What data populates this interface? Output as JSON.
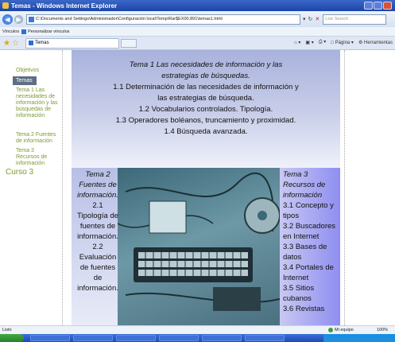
{
  "window": {
    "title": "Temas - Windows Internet Explorer"
  },
  "address": {
    "url": "C:\\Documents and Settings\\Administrador\\Configuración local\\Temp\\Rar$EX00.891\\temas1.html",
    "search_placeholder": "Live Search"
  },
  "links_bar": {
    "label": "Vínculos",
    "item": "Personalizar vínculos"
  },
  "tabs": [
    {
      "label": "Temas"
    }
  ],
  "command_bar": {
    "page": "Página",
    "tools": "Herramientas"
  },
  "sidebar": {
    "objetivos": "Objetivos",
    "temas": "Temas",
    "items": [
      "Tema 1 Las necesidades de información y las búsquedas de información",
      "Tema 2 Fuentes de información",
      "Tema 3 Recursos de información"
    ],
    "curso": "Curso 3"
  },
  "slide": {
    "tema1": {
      "title": "Tema 1 Las necesidades de información y las estrategias de búsquedas.",
      "lines": [
        "1.1 Determinación de las necesidades de información y las estrategias de búsqueda.",
        "1.2 Vocabularios controlados. Tipología.",
        "1.3 Operadores boléanos, truncamiento y proximidad.",
        "1.4 Búsqueda avanzada."
      ]
    },
    "tema2": {
      "title": "Tema 2 Fuentes de información.",
      "lines": [
        "2.1 Tipología de fuentes de información.",
        "2.2 Evaluación de fuentes de información."
      ]
    },
    "tema3": {
      "title": "Tema 3 Recursos de información",
      "lines": [
        "3.1 Concepto y tipos",
        "3.2 Buscadores en Internet",
        "3.3 Bases de datos",
        "3.4 Portales de Internet",
        "3.5 Sitios cubanos",
        "3.6 Revistas"
      ]
    }
  },
  "status": {
    "left": "Listo",
    "zone": "Mi equipo",
    "zoom": "100%"
  }
}
